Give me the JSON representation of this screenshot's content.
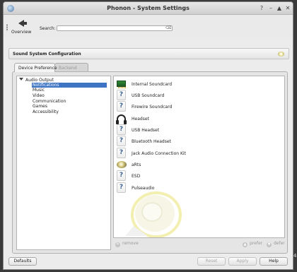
{
  "window": {
    "title": "Phonon - System Settings",
    "controls": {
      "help": "?",
      "minimize": "–",
      "maximize": "▲",
      "close": "✕"
    }
  },
  "toolbar": {
    "overview_label": "Overview",
    "search_label": "Search:",
    "search_value": "",
    "search_placeholder": "",
    "clear_icon": "⌫"
  },
  "header": {
    "title": "Sound System Configuration"
  },
  "tabs": [
    {
      "label": "Device Preference",
      "active": true
    },
    {
      "label": "Backend",
      "active": false
    }
  ],
  "tree": {
    "root": "Audio Output",
    "items": [
      {
        "label": "Notifications",
        "selected": true
      },
      {
        "label": "Music",
        "selected": false
      },
      {
        "label": "Video",
        "selected": false
      },
      {
        "label": "Communication",
        "selected": false
      },
      {
        "label": "Games",
        "selected": false
      },
      {
        "label": "Accessibility",
        "selected": false
      }
    ]
  },
  "devices": [
    {
      "label": "Internal Soundcard",
      "icon": "soundcard-icon"
    },
    {
      "label": "USB Soundcard",
      "icon": "unknown-device-icon"
    },
    {
      "label": "Firewire Soundcard",
      "icon": "unknown-device-icon"
    },
    {
      "label": "Headset",
      "icon": "headset-icon"
    },
    {
      "label": "USB Headset",
      "icon": "unknown-device-icon"
    },
    {
      "label": "Bluetooth Headset",
      "icon": "unknown-device-icon"
    },
    {
      "label": "Jack Audio Connection Kit",
      "icon": "unknown-device-icon"
    },
    {
      "label": "aRts",
      "icon": "speaker-icon"
    },
    {
      "label": "ESD",
      "icon": "unknown-device-icon"
    },
    {
      "label": "Pulseaudio",
      "icon": "unknown-device-icon"
    }
  ],
  "device_actions": {
    "remove": "remove",
    "prefer": "prefer",
    "defer": "defer"
  },
  "buttons": {
    "defaults": "Defaults",
    "reset": "Reset",
    "apply": "Apply",
    "help": "Help"
  },
  "edge_glyph": "4",
  "colors": {
    "selection": "#3d74c4",
    "window_bg": "#ececec",
    "desktop_bg": "#3a3a3a"
  }
}
